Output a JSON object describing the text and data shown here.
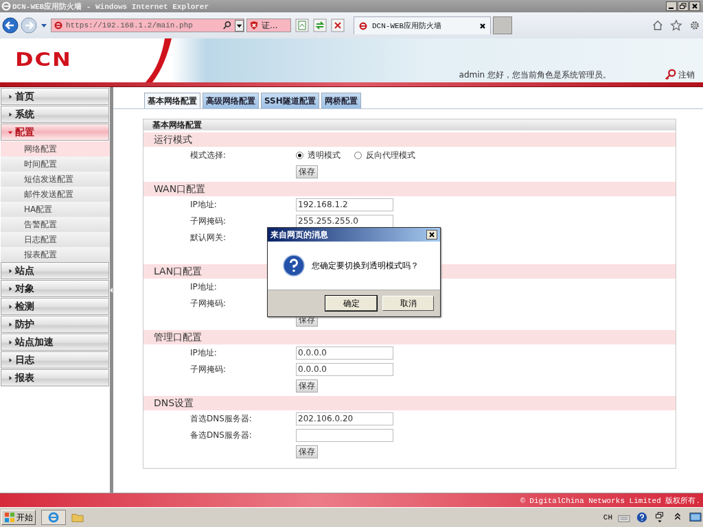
{
  "window": {
    "title": "DCN-WEB应用防火墙 - Windows Internet Explorer"
  },
  "browser": {
    "address": "https://192.168.1.2/main.php",
    "certificate_error": "证...",
    "tabs": [
      {
        "label": "DCN-WEB应用防火墙",
        "selected": true
      }
    ]
  },
  "header": {
    "logo": "DCN",
    "greeting": "admin 您好，您当前角色是系统管理员。",
    "logout": "注销"
  },
  "sidebar": {
    "items": [
      {
        "label": "首页",
        "expanded": false
      },
      {
        "label": "系统",
        "expanded": false
      },
      {
        "label": "配置",
        "expanded": true,
        "children": [
          {
            "label": "网络配置",
            "selected": true
          },
          {
            "label": "时间配置",
            "selected": false
          },
          {
            "label": "短信发送配置",
            "selected": false
          },
          {
            "label": "邮件发送配置",
            "selected": false
          },
          {
            "label": "HA配置",
            "selected": false
          },
          {
            "label": "告警配置",
            "selected": false
          },
          {
            "label": "日志配置",
            "selected": false
          },
          {
            "label": "报表配置",
            "selected": false
          }
        ]
      },
      {
        "label": "站点",
        "expanded": false
      },
      {
        "label": "对象",
        "expanded": false
      },
      {
        "label": "检测",
        "expanded": false
      },
      {
        "label": "防护",
        "expanded": false
      },
      {
        "label": "站点加速",
        "expanded": false
      },
      {
        "label": "日志",
        "expanded": false
      },
      {
        "label": "报表",
        "expanded": false
      }
    ]
  },
  "tabs": [
    {
      "label": "基本网络配置",
      "selected": true
    },
    {
      "label": "高级网络配置",
      "selected": false
    },
    {
      "label": "SSH隧道配置",
      "selected": false
    },
    {
      "label": "网桥配置",
      "selected": false
    }
  ],
  "panel": {
    "title": "基本网络配置",
    "sections": [
      {
        "title": "运行模式",
        "kind": "radio",
        "label": "模式选择:",
        "options": [
          {
            "label": "透明模式",
            "selected": true
          },
          {
            "label": "反向代理模式",
            "selected": false
          }
        ],
        "save": "保存"
      },
      {
        "title": "WAN口配置",
        "kind": "fields",
        "fields": [
          {
            "label": "IP地址:",
            "input": true,
            "value": "192.168.1.2"
          },
          {
            "label": "子网掩码:",
            "input": true,
            "value": "255.255.255.0"
          },
          {
            "label": "默认网关:"
          }
        ]
      },
      {
        "title": "LAN口配置",
        "kind": "fields",
        "fields": [
          {
            "label": "IP地址:"
          },
          {
            "label": "子网掩码:"
          }
        ],
        "save": "保存"
      },
      {
        "title": "管理口配置",
        "kind": "fields",
        "fields": [
          {
            "label": "IP地址:",
            "input": true,
            "value": "0.0.0.0"
          },
          {
            "label": "子网掩码:",
            "input": true,
            "value": "0.0.0.0"
          }
        ],
        "save": "保存"
      },
      {
        "title": "DNS设置",
        "kind": "fields",
        "fields": [
          {
            "label": "首选DNS服务器:",
            "input": true,
            "value": "202.106.0.20"
          },
          {
            "label": "备选DNS服务器:",
            "input": true
          }
        ],
        "save": "保存"
      }
    ]
  },
  "dialog": {
    "title": "来自网页的消息",
    "message": "您确定要切换到透明模式吗？",
    "buttons": [
      "确定",
      "取消"
    ]
  },
  "footer": {
    "copyright": "© DigitalChina Networks Limited 版权所有."
  },
  "taskbar": {
    "start": "开始",
    "language": "CH"
  }
}
